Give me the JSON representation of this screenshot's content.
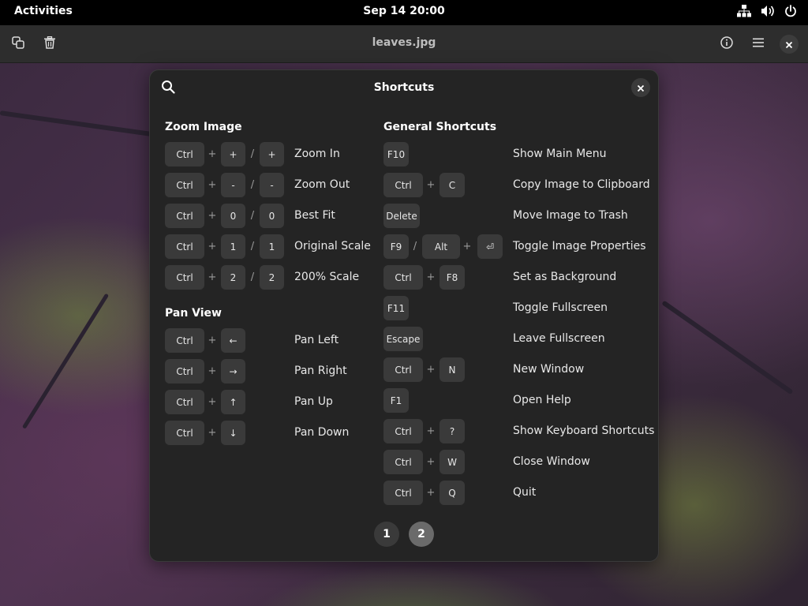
{
  "topbar": {
    "activities": "Activities",
    "clock": "Sep 14  20:00",
    "icons": [
      "network-icon",
      "volume-icon",
      "power-icon"
    ]
  },
  "appbar": {
    "title": "leaves.jpg",
    "icons": [
      "copy-icon",
      "trash-icon",
      "info-icon",
      "menu-icon",
      "close-icon"
    ]
  },
  "dialog": {
    "title": "Shortcuts",
    "zoom": {
      "title": "Zoom Image",
      "rows": [
        {
          "k1": "Ctrl",
          "plus": "+",
          "k2": "+",
          "slash": "/",
          "k3": "+",
          "desc": "Zoom In"
        },
        {
          "k1": "Ctrl",
          "plus": "+",
          "k2": "-",
          "slash": "/",
          "k3": "-",
          "desc": "Zoom Out"
        },
        {
          "k1": "Ctrl",
          "plus": "+",
          "k2": "0",
          "slash": "/",
          "k3": "0",
          "desc": "Best Fit"
        },
        {
          "k1": "Ctrl",
          "plus": "+",
          "k2": "1",
          "slash": "/",
          "k3": "1",
          "desc": "Original Scale"
        },
        {
          "k1": "Ctrl",
          "plus": "+",
          "k2": "2",
          "slash": "/",
          "k3": "2",
          "desc": "200% Scale"
        }
      ]
    },
    "pan": {
      "title": "Pan View",
      "rows": [
        {
          "k1": "Ctrl",
          "plus": "+",
          "k2": "←",
          "desc": "Pan Left"
        },
        {
          "k1": "Ctrl",
          "plus": "+",
          "k2": "→",
          "desc": "Pan Right"
        },
        {
          "k1": "Ctrl",
          "plus": "+",
          "k2": "↑",
          "desc": "Pan Up"
        },
        {
          "k1": "Ctrl",
          "plus": "+",
          "k2": "↓",
          "desc": "Pan Down"
        }
      ]
    },
    "general": {
      "title": "General Shortcuts",
      "rows": [
        {
          "k1": "F10",
          "desc": "Show Main Menu"
        },
        {
          "k1": "Ctrl",
          "plus": "+",
          "k2": "C",
          "desc": "Copy Image to Clipboard"
        },
        {
          "k1": "Delete",
          "desc": "Move Image to Trash"
        },
        {
          "k1": "F9",
          "slash": "/",
          "k2": "Alt",
          "plus": "+",
          "k3": "⏎",
          "desc": "Toggle Image Properties"
        },
        {
          "k1": "Ctrl",
          "plus": "+",
          "k2": "F8",
          "desc": "Set as Background"
        },
        {
          "k1": "F11",
          "desc": "Toggle Fullscreen"
        },
        {
          "k1": "Escape",
          "desc": "Leave Fullscreen"
        },
        {
          "k1": "Ctrl",
          "plus": "+",
          "k2": "N",
          "desc": "New Window"
        },
        {
          "k1": "F1",
          "desc": "Open Help"
        },
        {
          "k1": "Ctrl",
          "plus": "+",
          "k2": "?",
          "desc": "Show Keyboard Shortcuts"
        },
        {
          "k1": "Ctrl",
          "plus": "+",
          "k2": "W",
          "desc": "Close Window"
        },
        {
          "k1": "Ctrl",
          "plus": "+",
          "k2": "Q",
          "desc": "Quit"
        }
      ]
    },
    "pages": [
      "1",
      "2"
    ],
    "current_page": "2"
  }
}
